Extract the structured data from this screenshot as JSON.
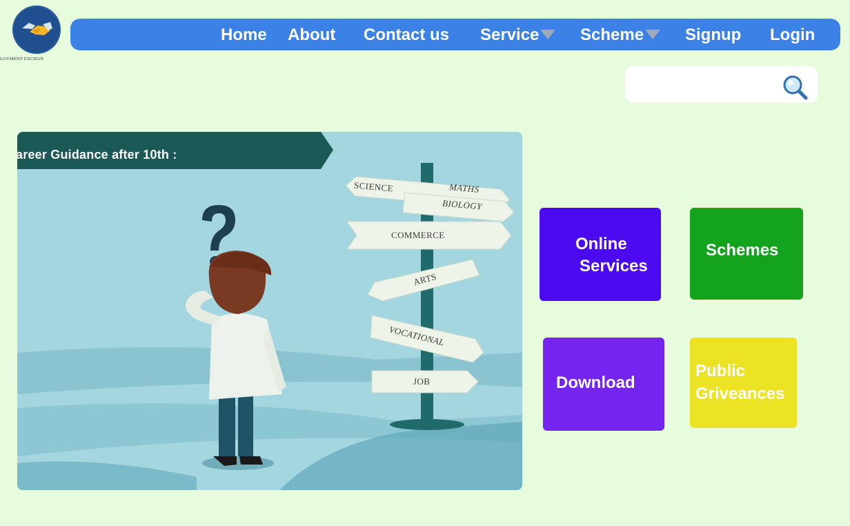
{
  "logo": {
    "caption": "LOYMENT EXCHAN",
    "icon": "handshake-icon",
    "circle_color": "#1f4f8f"
  },
  "nav": {
    "background": "#3c82e6",
    "items": [
      {
        "label": "Home"
      },
      {
        "label": "About"
      },
      {
        "label": "Contact us"
      },
      {
        "label": "Service",
        "dropdown": true
      },
      {
        "label": "Scheme",
        "dropdown": true
      },
      {
        "label": "Signup"
      },
      {
        "label": "Login"
      }
    ]
  },
  "search": {
    "value": "",
    "placeholder": "",
    "icon": "magnifier-icon"
  },
  "hero": {
    "ribbon_text": "areer Guidance after 10th :",
    "signs": [
      "SCIENCE",
      "MATHS",
      "BIOLOGY",
      "COMMERCE",
      "ARTS",
      "VOCATIONAL",
      "JOB"
    ]
  },
  "tiles": {
    "online_line1": "Online",
    "online_line2": "Services",
    "schemes": "Schemes",
    "download": "Download",
    "public_line1": "Public",
    "public_line2": "Griveances",
    "colors": {
      "online": "#4c0af0",
      "schemes": "#13a31d",
      "download": "#7426f0",
      "public": "#ece324"
    }
  }
}
